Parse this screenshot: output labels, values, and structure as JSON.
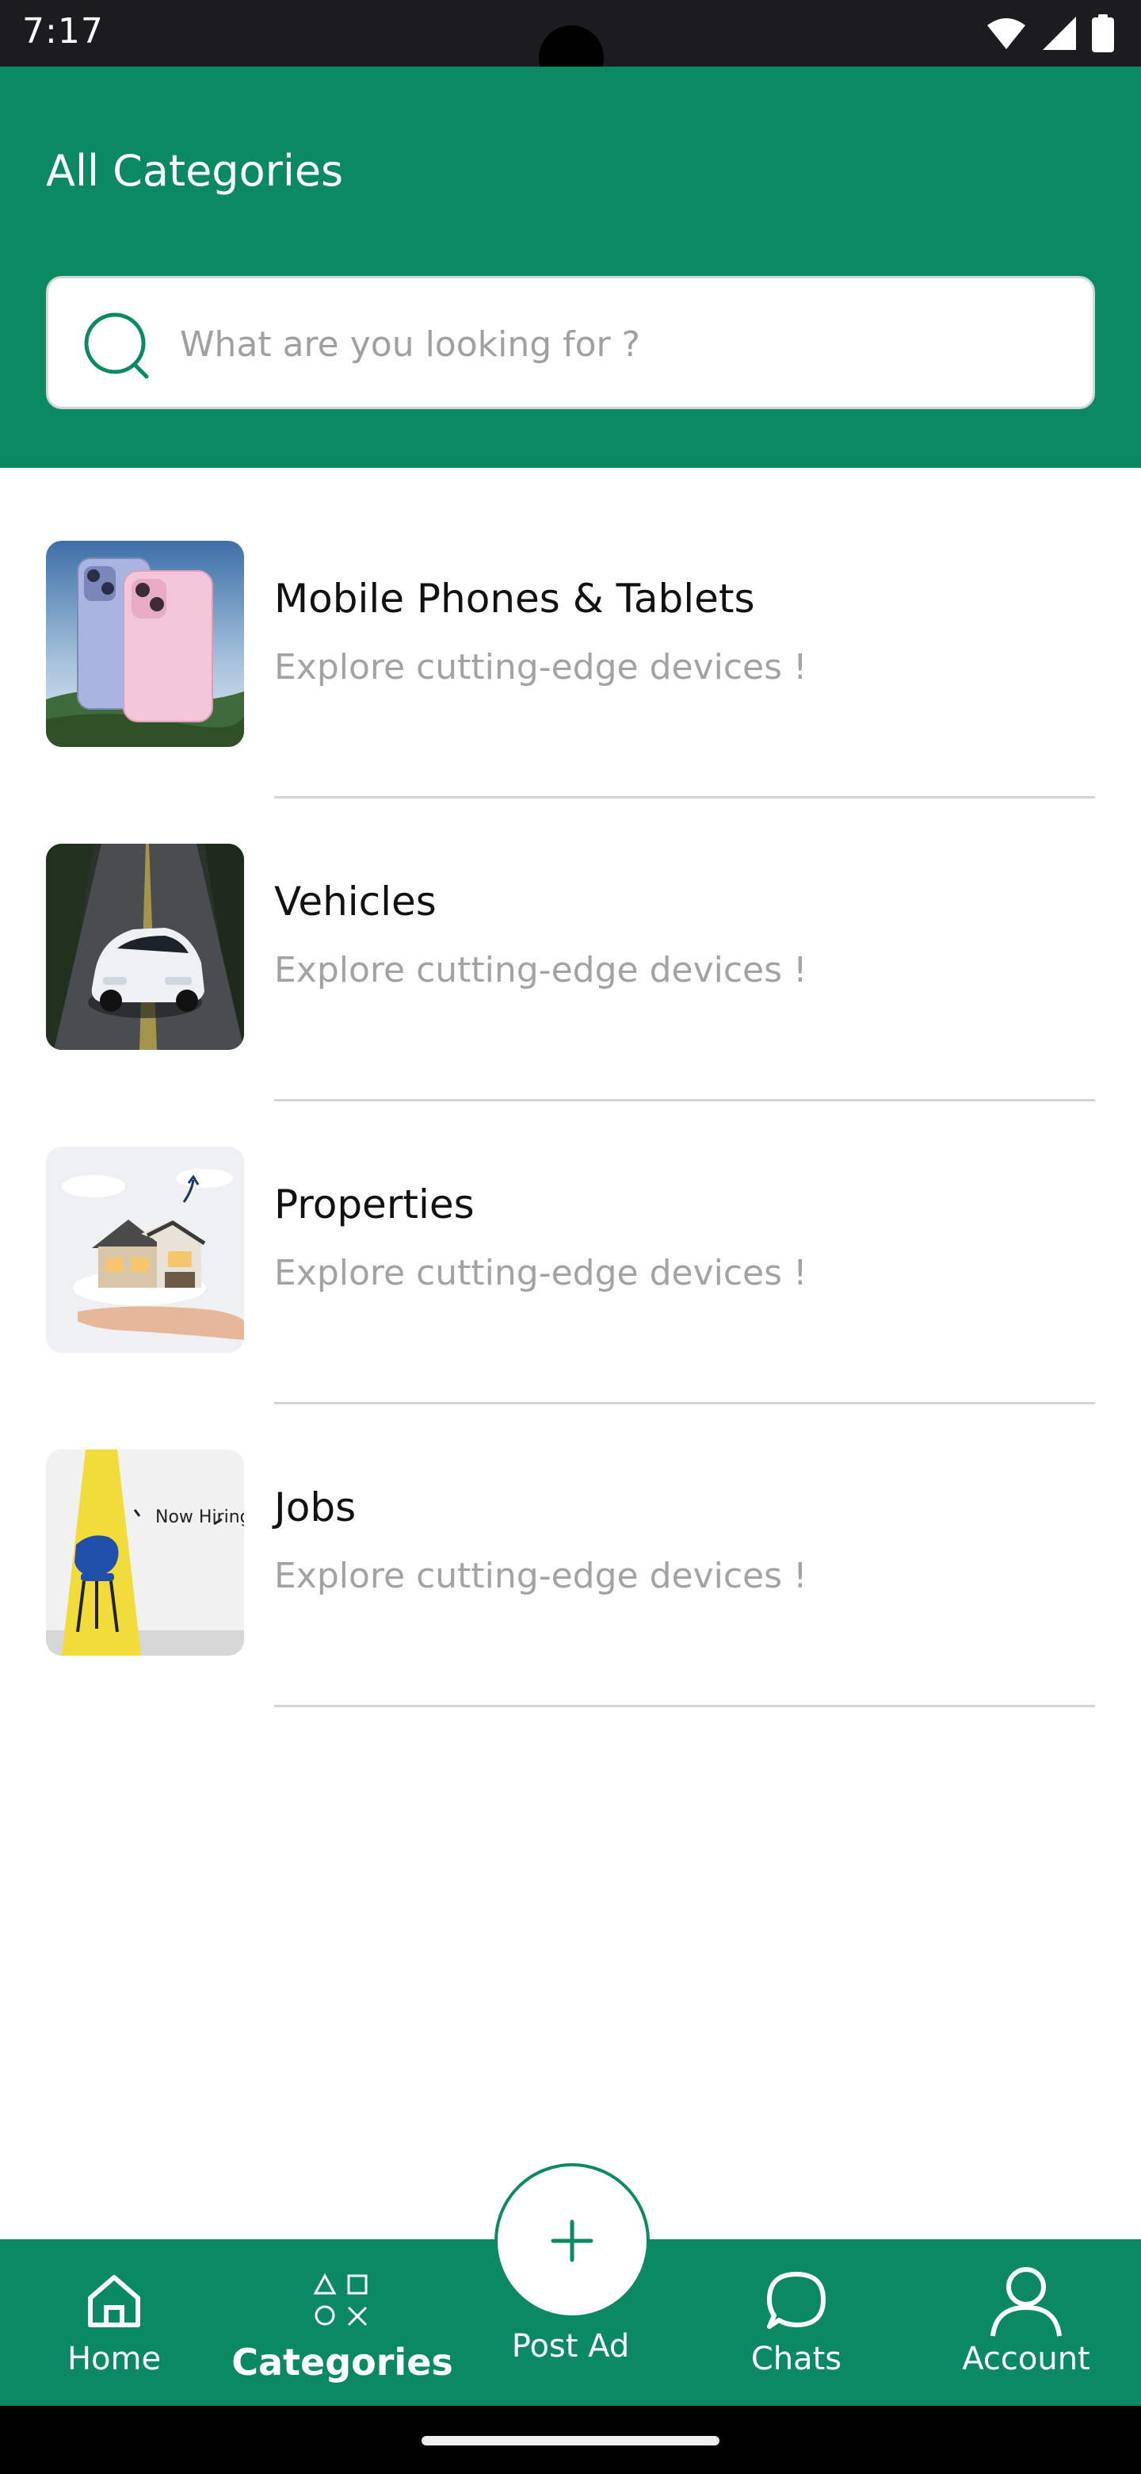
{
  "status_bar": {
    "time": "7:17"
  },
  "header": {
    "title": "All Categories",
    "search": {
      "placeholder": "What are you looking for ?",
      "value": ""
    }
  },
  "categories": [
    {
      "name": "Mobile Phones & Tablets",
      "description": "Explore cutting-edge devices !",
      "image": "phones-image"
    },
    {
      "name": "Vehicles",
      "description": "Explore cutting-edge devices !",
      "image": "car-image"
    },
    {
      "name": "Properties",
      "description": "Explore cutting-edge devices !",
      "image": "house-image"
    },
    {
      "name": "Jobs",
      "description": "Explore cutting-edge devices !",
      "image": "now-hiring-image",
      "image_text": "Now Hiring"
    }
  ],
  "bottom_nav": {
    "home": "Home",
    "categories": "Categories",
    "post_ad": "Post Ad",
    "chats": "Chats",
    "account": "Account",
    "active": "categories"
  },
  "colors": {
    "brand_green": "#0b8a61",
    "status_bar": "#1c1c1e",
    "muted_text": "#a3a3a3"
  }
}
